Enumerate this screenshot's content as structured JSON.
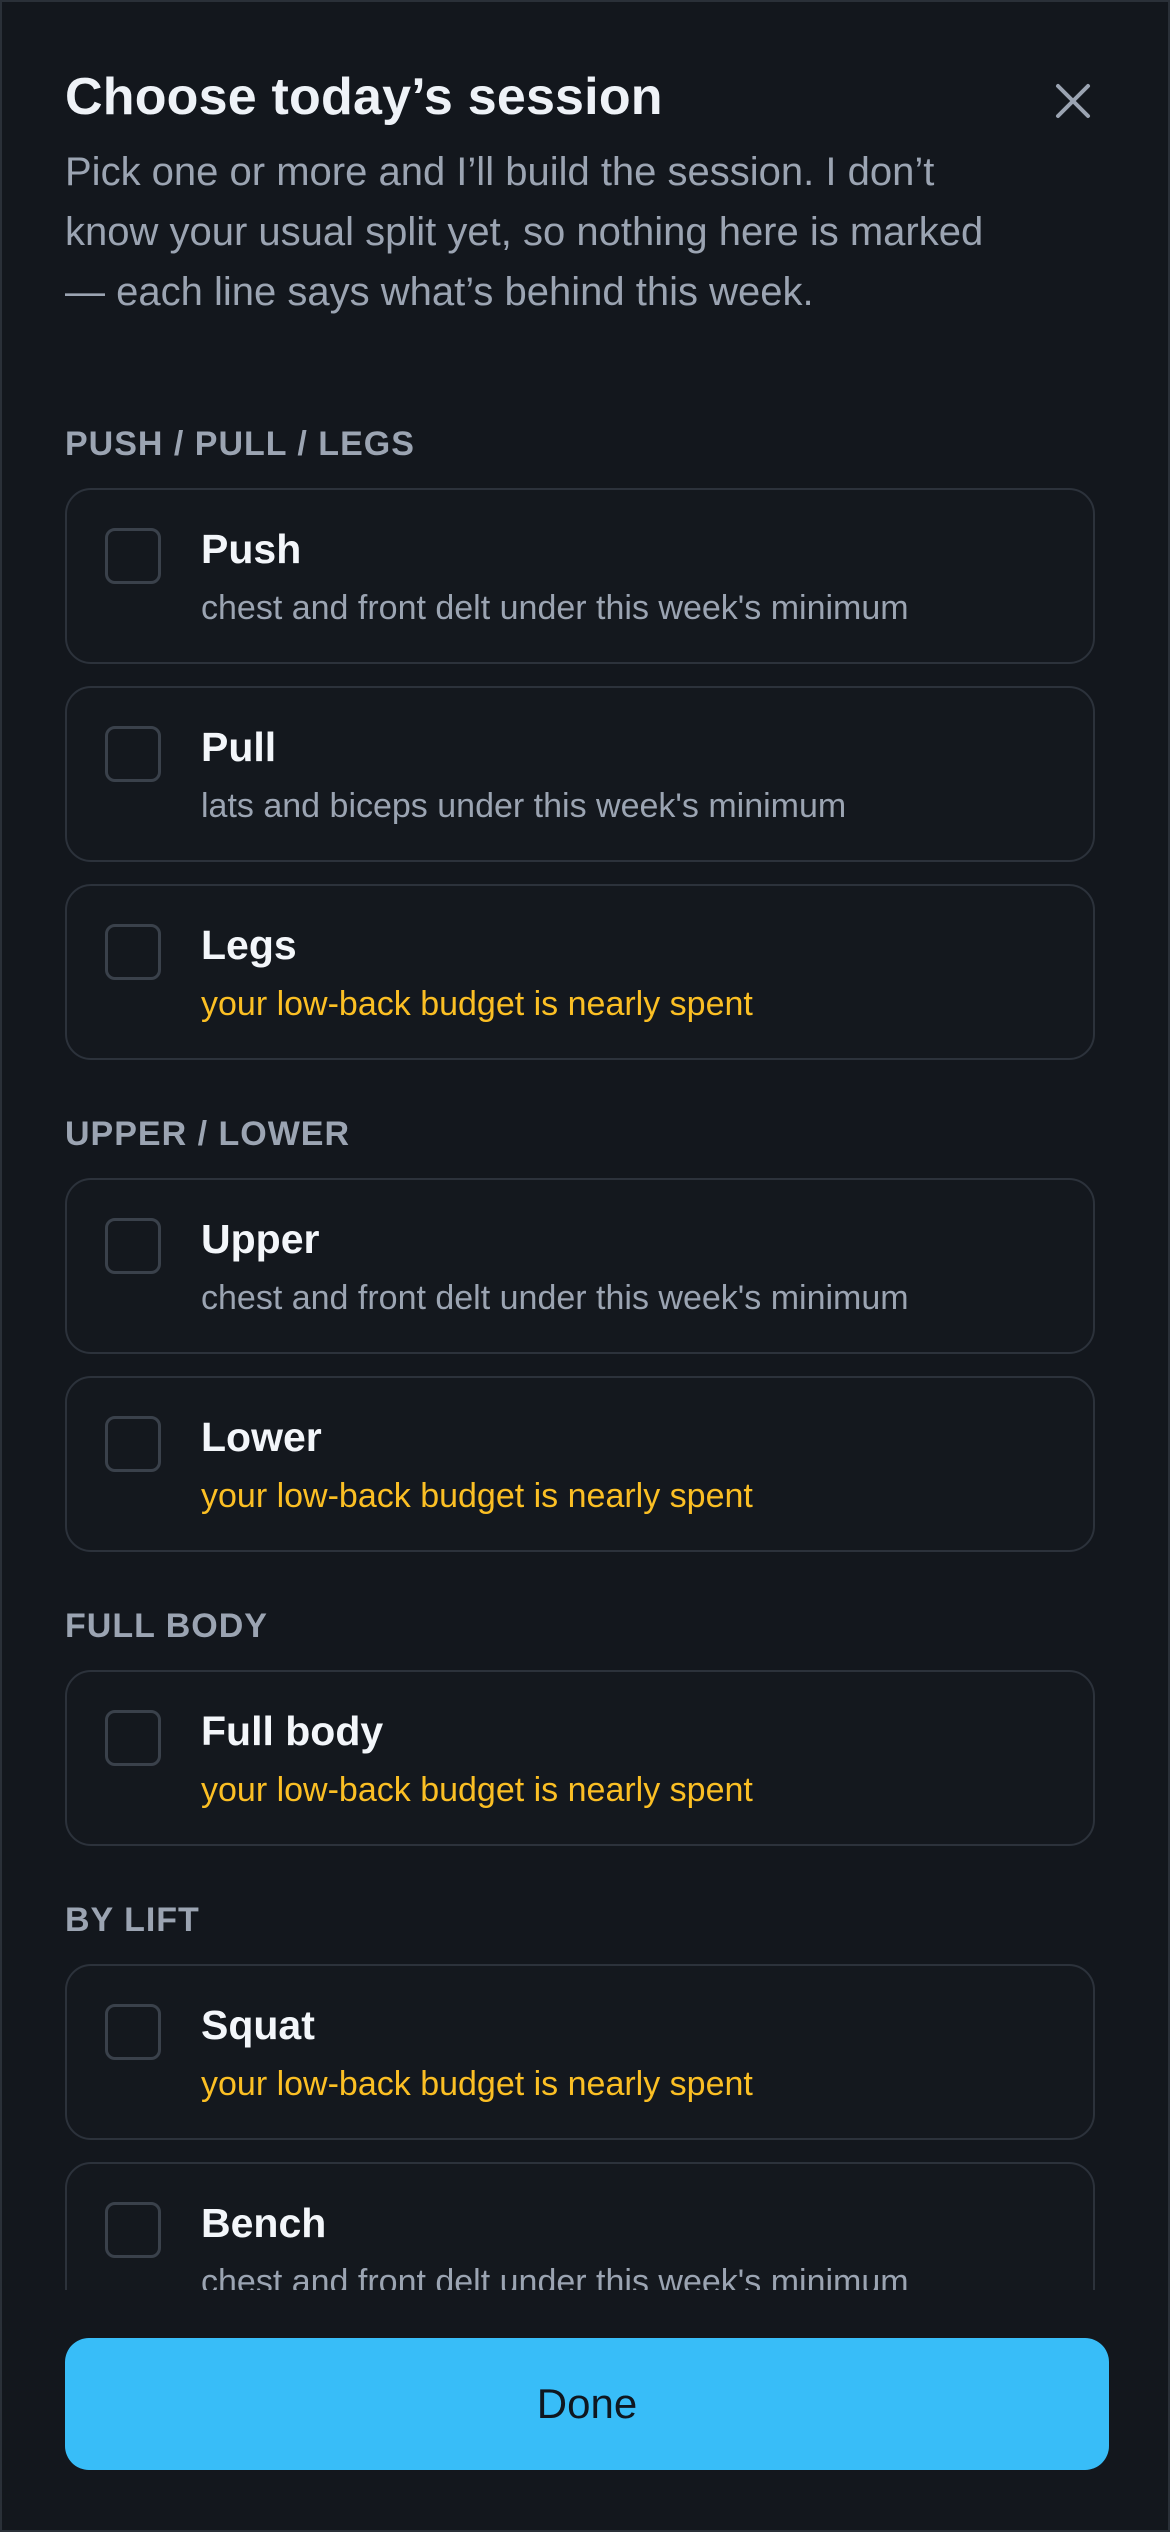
{
  "header": {
    "title": "Choose today’s session",
    "subtitle": "Pick one or more and I’ll build the session. I don’t know your usual split yet, so nothing here is marked — each line says what’s behind this week."
  },
  "close_icon": "close-icon",
  "sections": [
    {
      "label": "PUSH / PULL / LEGS",
      "options": [
        {
          "name": "Push",
          "note": "chest and front delt under this week's minimum",
          "warning": false,
          "checked": false
        },
        {
          "name": "Pull",
          "note": "lats and biceps under this week's minimum",
          "warning": false,
          "checked": false
        },
        {
          "name": "Legs",
          "note": "your low-back budget is nearly spent",
          "warning": true,
          "checked": false
        }
      ]
    },
    {
      "label": "UPPER / LOWER",
      "options": [
        {
          "name": "Upper",
          "note": "chest and front delt under this week's minimum",
          "warning": false,
          "checked": false
        },
        {
          "name": "Lower",
          "note": "your low-back budget is nearly spent",
          "warning": true,
          "checked": false
        }
      ]
    },
    {
      "label": "FULL BODY",
      "options": [
        {
          "name": "Full body",
          "note": "your low-back budget is nearly spent",
          "warning": true,
          "checked": false
        }
      ]
    },
    {
      "label": "BY LIFT",
      "options": [
        {
          "name": "Squat",
          "note": "your low-back budget is nearly spent",
          "warning": true,
          "checked": false
        },
        {
          "name": "Bench",
          "note": "chest and front delt under this week's minimum",
          "warning": false,
          "checked": false
        }
      ]
    }
  ],
  "footer": {
    "done_label": "Done"
  },
  "colors": {
    "background": "#13171d",
    "card_border": "#2c323b",
    "text_primary": "#eef2f7",
    "text_muted": "#9ba4b2",
    "warning": "#fbbf24",
    "accent": "#38bdf8"
  }
}
